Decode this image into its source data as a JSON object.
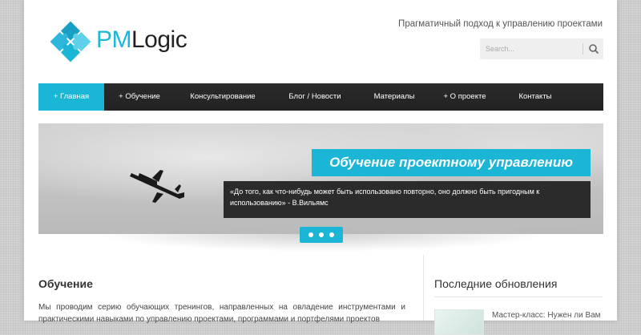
{
  "header": {
    "logo_prefix": "PM",
    "logo_suffix": "Logic",
    "tagline": "Прагматичный подход к управлению проектами"
  },
  "search": {
    "placeholder": "Search..."
  },
  "nav": {
    "items": [
      {
        "label": "+ Главная",
        "active": true
      },
      {
        "label": "+ Обучение",
        "active": false
      },
      {
        "label": "Консультирование",
        "active": false
      },
      {
        "label": "Блог / Новости",
        "active": false
      },
      {
        "label": "Материалы",
        "active": false
      },
      {
        "label": "+ О проекте",
        "active": false
      },
      {
        "label": "Контакты",
        "active": false
      }
    ]
  },
  "slider": {
    "title": "Обучение проектному управлению",
    "quote": "«До того, как что-нибудь может быть использовано повторно, оно должно быть пригодным к использованию» - В.Вильямс",
    "slide_count": 3,
    "current_slide": 1
  },
  "main": {
    "title": "Обучение",
    "text": "Мы проводим серию обучающих тренингов, направленных на овладение инструментами и практическими навыками по управлению проектами, программами и портфелями проектов"
  },
  "sidebar": {
    "title": "Последние обновления",
    "items": [
      {
        "title": "Мастер-класс: Нужен ли Вам"
      }
    ]
  },
  "colors": {
    "accent": "#1bb5d5",
    "nav_bg": "#2b2b2b",
    "page_bg": "#d2d2d2"
  }
}
